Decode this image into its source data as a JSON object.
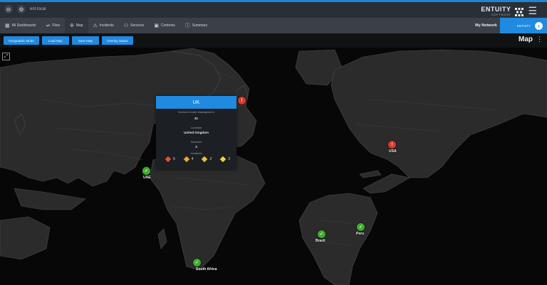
{
  "app": {
    "brand_name": "ENTUITY",
    "brand_sub": "SOFTWARE"
  },
  "topbar": {
    "left_text": "ent.local"
  },
  "nav": {
    "tabs": [
      {
        "label": "All Dashboards",
        "icon": "dashboard-icon"
      },
      {
        "label": "Flow",
        "icon": "flow-icon"
      },
      {
        "label": "Map",
        "icon": "map-icon"
      },
      {
        "label": "Incidents",
        "icon": "incident-icon"
      },
      {
        "label": "Services",
        "icon": "services-icon"
      },
      {
        "label": "Contexts",
        "icon": "contexts-icon"
      },
      {
        "label": "Summary",
        "icon": "info-icon"
      }
    ],
    "my_network": "My Network",
    "context_button": "ENTUITY"
  },
  "toolbar": {
    "buttons": [
      "Geographic Mode",
      "Load Map",
      "Save Map",
      "Overlay Status"
    ],
    "title": "Map"
  },
  "map": {
    "colors": {
      "ocean": "#070707",
      "land": "#2b2b2b",
      "border": "#4a4a4a",
      "accent": "#1f8ae0"
    },
    "sites": [
      {
        "label": "UAE",
        "status": "ok"
      },
      {
        "label": "UK",
        "status": "alert"
      },
      {
        "label": "USA",
        "status": "alert"
      },
      {
        "label": "Peru",
        "status": "ok"
      },
      {
        "label": "Brazil",
        "status": "ok"
      },
      {
        "label": "South Africa",
        "status": "ok"
      }
    ]
  },
  "popup": {
    "title": "UK",
    "rows": [
      {
        "label": "Devices Under Management",
        "value": "41"
      },
      {
        "label": "Location",
        "value": "United Kingdom"
      },
      {
        "label": "Services",
        "value": "3"
      },
      {
        "label": "Incidents",
        "value": "3"
      }
    ],
    "severity_counts": [
      {
        "value": "5",
        "color": "#e0522f"
      },
      {
        "value": "4",
        "color": "#f0a42a"
      },
      {
        "value": "2",
        "color": "#f0c22a"
      },
      {
        "value": "3",
        "color": "#f2d23a"
      }
    ]
  }
}
